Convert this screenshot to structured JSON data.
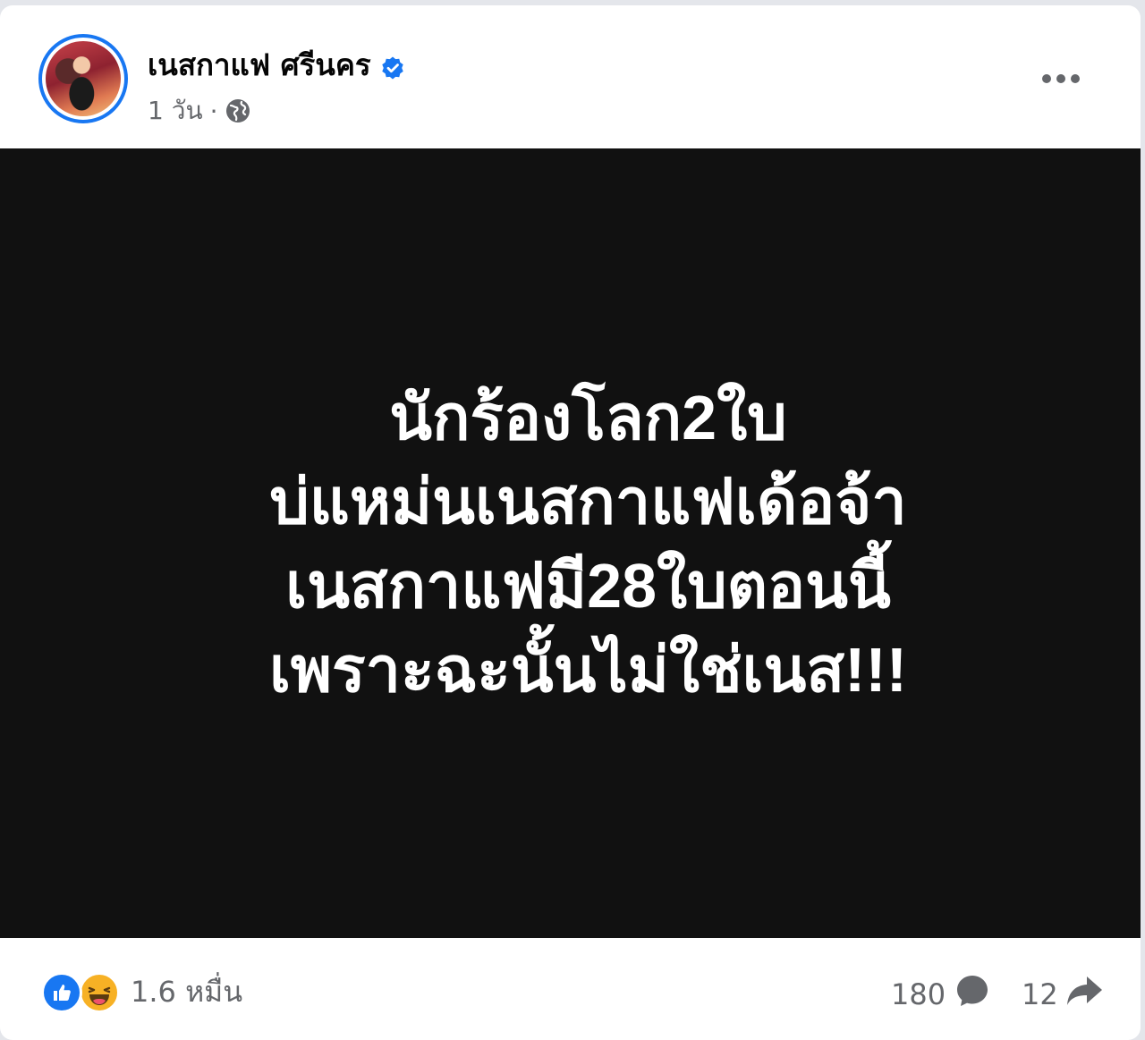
{
  "post": {
    "author": "เนสกาแฟ ศรีนคร",
    "time": "1 วัน",
    "separator": "·",
    "image_lines": [
      "นักร้องโลก2ใบ",
      "บ่แหม่นเนสกาแฟเด้อจ้า",
      "เนสกาแฟมี28ใบตอนนี้",
      "เพราะฉะนั้นไม่ใช่เนส!!!"
    ]
  },
  "stats": {
    "reactions": "1.6 หมื่น",
    "comments": "180",
    "shares": "12"
  },
  "icons": {
    "verified": "verified-badge-icon",
    "audience": "globe-icon",
    "more": "more-options-icon",
    "like": "like-reaction-icon",
    "haha": "haha-reaction-icon",
    "comment": "comment-bubble-icon",
    "share": "share-arrow-icon"
  },
  "colors": {
    "brand": "#1877f2",
    "image_bg": "#111111",
    "secondary_text": "#65676b",
    "haha": "#f7b125"
  }
}
